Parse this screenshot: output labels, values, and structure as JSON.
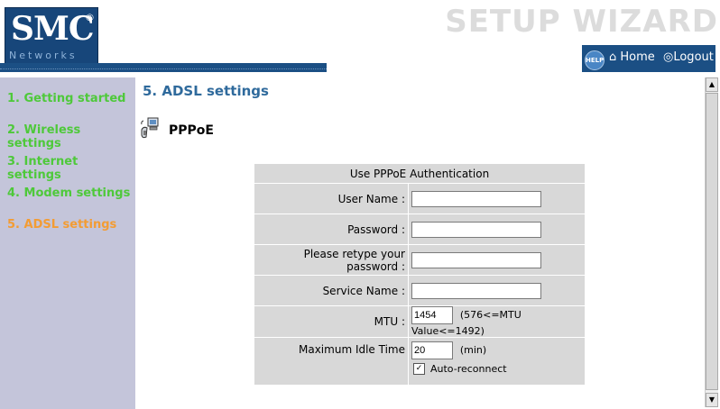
{
  "header": {
    "logo_text": "SMC",
    "logo_reg": "®",
    "logo_sub": "Networks",
    "wizard_title": "SETUP WIZARD",
    "help_label": "HELP",
    "home_label": "Home",
    "logout_label": "Logout",
    "bar_color": "#1b4f84"
  },
  "sidebar": {
    "items": [
      {
        "label": "1. Getting started",
        "active": false
      },
      {
        "label": "2. Wireless settings",
        "active": false
      },
      {
        "label": "3. Internet settings",
        "active": false
      },
      {
        "label": "4. Modem settings",
        "active": false
      },
      {
        "label": "5. ADSL settings",
        "active": true
      }
    ],
    "item_color": "#4ec93a",
    "active_color": "#f39c33"
  },
  "main": {
    "heading": "5. ADSL settings",
    "section_label": "PPPoE",
    "form": {
      "header": "Use PPPoE Authentication",
      "username_label": "User Name :",
      "username_value": "",
      "password_label": "Password :",
      "password_value": "",
      "retype_label": "Please retype your password :",
      "retype_value": "",
      "service_label": "Service Name :",
      "service_value": "",
      "mtu_label": "MTU :",
      "mtu_value": "1454",
      "mtu_hint": "(576<=MTU Value<=1492)",
      "idle_label": "Maximum Idle Time",
      "idle_value": "20",
      "idle_unit": "(min)",
      "auto_reconnect_label": "Auto-reconnect",
      "auto_reconnect_checked": true
    }
  }
}
